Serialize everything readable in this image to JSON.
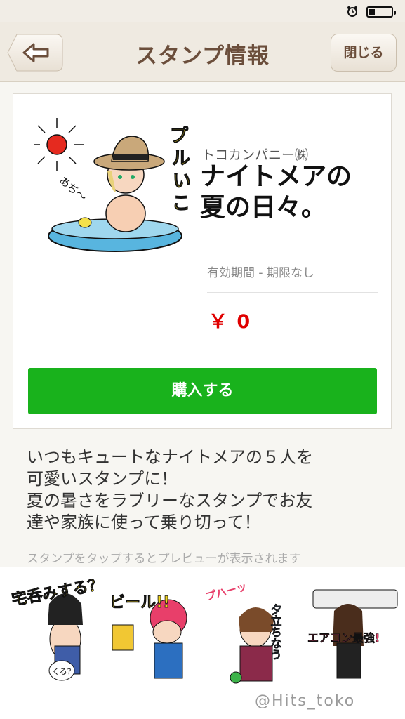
{
  "header": {
    "title": "スタンプ情報",
    "close_label": "閉じる"
  },
  "sticker": {
    "publisher": "トコカンパニー㈱",
    "title_line1": "ナイトメアの",
    "title_line2": "夏の日々。",
    "validity": "有効期間 - 期限なし",
    "price": "￥ 0",
    "buy_label": "購入する",
    "main_image": {
      "text_lines": [
        "プ",
        "ル",
        "い",
        "こ"
      ],
      "caption": "あぢ〜"
    }
  },
  "description": {
    "lines": [
      "いつもキュートなナイトメアの５人を",
      "可愛いスタンプに！",
      "夏の暑さをラブリーなスタンプでお友",
      "達や家族に使って乗り切って！"
    ],
    "hint": "スタンプをタップするとプレビューが表示されます"
  },
  "preview": {
    "items": [
      {
        "text": "宅呑みする？",
        "bubble": "くる？"
      },
      {
        "text": "ビール!!"
      },
      {
        "text": "プハーッ",
        "text2": "夕立ちなう"
      },
      {
        "text": "エアコン最強!"
      }
    ]
  },
  "watermark": "@Hits_toko",
  "colors": {
    "accent_green": "#19b21c",
    "price_red": "#e00000",
    "header_brown": "#6b4e3b"
  }
}
